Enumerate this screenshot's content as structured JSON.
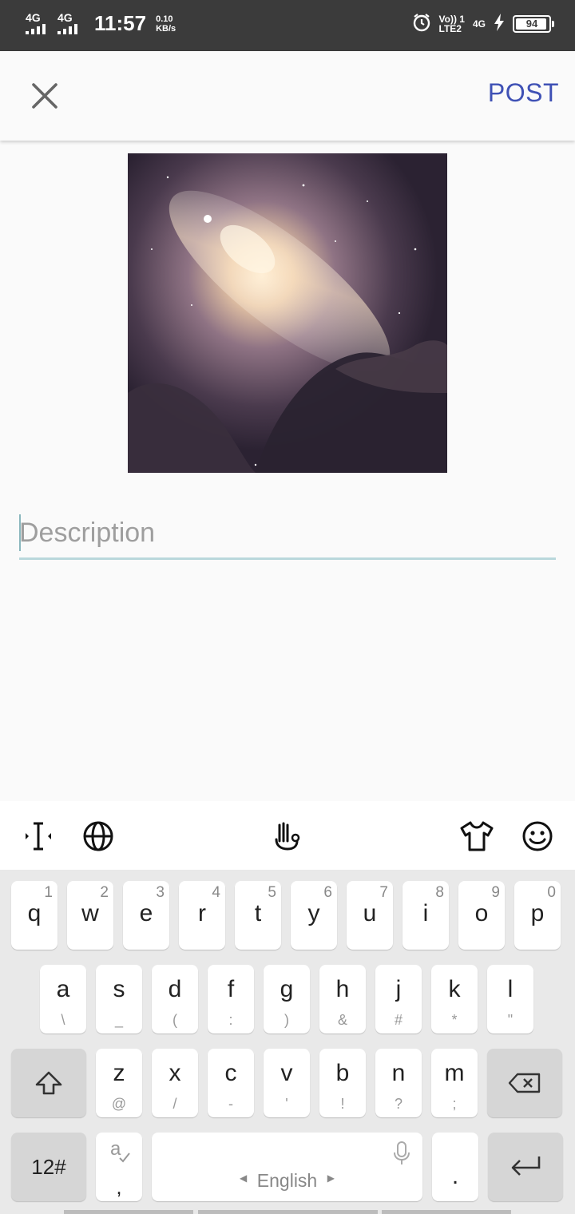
{
  "status_bar": {
    "net1": "4G",
    "net2": "4G",
    "time": "11:57",
    "speed_value": "0.10",
    "speed_unit": "KB/s",
    "volte_top": "Vo)) 1",
    "volte_bottom": "LTE2",
    "net3": "4G",
    "battery": "94",
    "icons": [
      "alarm-icon",
      "charging-icon"
    ]
  },
  "toolbar": {
    "close_icon": "close-icon",
    "post_label": "POST",
    "accent": "#3f51b5"
  },
  "image": {
    "alt": "nebula"
  },
  "description": {
    "placeholder": "Description",
    "value": ""
  },
  "keyboard_toolbar": {
    "icons": [
      "text-cursor-icon",
      "globe-icon",
      "touchpal-icon",
      "theme-shirt-icon",
      "emoji-icon"
    ]
  },
  "keyboard": {
    "row1": [
      {
        "k": "q",
        "n": "1"
      },
      {
        "k": "w",
        "n": "2"
      },
      {
        "k": "e",
        "n": "3"
      },
      {
        "k": "r",
        "n": "4"
      },
      {
        "k": "t",
        "n": "5"
      },
      {
        "k": "y",
        "n": "6"
      },
      {
        "k": "u",
        "n": "7"
      },
      {
        "k": "i",
        "n": "8"
      },
      {
        "k": "o",
        "n": "9"
      },
      {
        "k": "p",
        "n": "0"
      }
    ],
    "row2": [
      {
        "k": "a",
        "s": "\\"
      },
      {
        "k": "s",
        "s": "_"
      },
      {
        "k": "d",
        "s": "("
      },
      {
        "k": "f",
        "s": ":"
      },
      {
        "k": "g",
        "s": ")"
      },
      {
        "k": "h",
        "s": "&"
      },
      {
        "k": "j",
        "s": "#"
      },
      {
        "k": "k",
        "s": "*"
      },
      {
        "k": "l",
        "s": "\""
      }
    ],
    "row3": [
      {
        "k": "z",
        "s": "@"
      },
      {
        "k": "x",
        "s": "/"
      },
      {
        "k": "c",
        "s": "-"
      },
      {
        "k": "v",
        "s": "'"
      },
      {
        "k": "b",
        "s": "!"
      },
      {
        "k": "n",
        "s": "?"
      },
      {
        "k": "m",
        "s": ";"
      }
    ],
    "numbers_label": "12#",
    "comma": ",",
    "space_label": "English",
    "period": "."
  }
}
